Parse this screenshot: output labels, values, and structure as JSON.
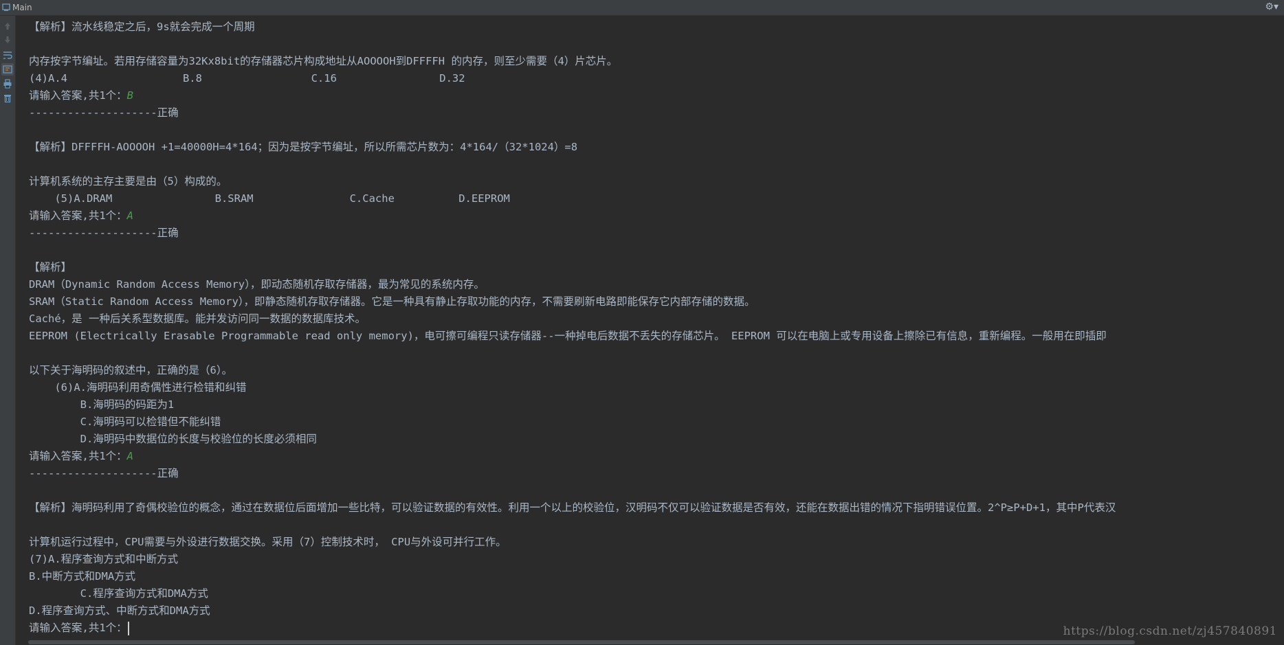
{
  "window": {
    "title": "Main"
  },
  "console": {
    "lines": [
      {
        "text": "【解析】流水线稳定之后，9s就会完成一个周期"
      },
      {
        "text": ""
      },
      {
        "text": "内存按字节编址。若用存储容量为32Kx8bit的存储器芯片构成地址从AOOOOH到DFFFFH 的内存，则至少需要（4）片芯片。"
      },
      {
        "text": "(4)A.4                  B.8                 C.16                D.32"
      },
      {
        "text": "请输入答案,共1个：",
        "input": "B"
      },
      {
        "text": "--------------------正确"
      },
      {
        "text": ""
      },
      {
        "text": "【解析】DFFFFH-AOOOOH +1=40000H=4*164；因为是按字节编址，所以所需芯片数为：4*164/（32*1024）=8"
      },
      {
        "text": ""
      },
      {
        "text": "计算机系统的主存主要是由（5）构成的。"
      },
      {
        "text": "    (5)A.DRAM                B.SRAM               C.Cache          D.EEPROM"
      },
      {
        "text": "请输入答案,共1个：",
        "input": "A"
      },
      {
        "text": "--------------------正确"
      },
      {
        "text": ""
      },
      {
        "text": "【解析】"
      },
      {
        "text": "DRAM（Dynamic Random Access Memory），即动态随机存取存储器，最为常见的系统内存。"
      },
      {
        "text": "SRAM（Static Random Access Memory），即静态随机存取存储器。它是一种具有静止存取功能的内存，不需要刷新电路即能保存它内部存储的数据。"
      },
      {
        "text": "Caché，是 一种后关系型数据库。能并发访问同一数据的数据库技术。"
      },
      {
        "text": "EEPROM (Electrically Erasable Programmable read only memory)，电可擦可编程只读存储器--一种掉电后数据不丢失的存储芯片。 EEPROM 可以在电脑上或专用设备上擦除已有信息，重新编程。一般用在即插即"
      },
      {
        "text": ""
      },
      {
        "text": "以下关于海明码的叙述中，正确的是（6）。"
      },
      {
        "text": "    (6)A.海明码利用奇偶性进行检错和纠错"
      },
      {
        "text": "        B.海明码的码距为1"
      },
      {
        "text": "        C.海明码可以检错但不能纠错"
      },
      {
        "text": "        D.海明码中数据位的长度与校验位的长度必须相同"
      },
      {
        "text": "请输入答案,共1个：",
        "input": "A"
      },
      {
        "text": "--------------------正确"
      },
      {
        "text": ""
      },
      {
        "text": "【解析】海明码利用了奇偶校验位的概念，通过在数据位后面增加一些比特，可以验证数据的有效性。利用一个以上的校验位，汉明码不仅可以验证数据是否有效，还能在数据出错的情况下指明错误位置。2^P≥P+D+1，其中P代表汉"
      },
      {
        "text": ""
      },
      {
        "text": "计算机运行过程中，CPU需要与外设进行数据交换。采用（7）控制技术时， CPU与外设可并行工作。"
      },
      {
        "text": "(7)A.程序查询方式和中断方式"
      },
      {
        "text": "B.中断方式和DMA方式"
      },
      {
        "text": "        C.程序查询方式和DMA方式"
      },
      {
        "text": "D.程序查询方式、中断方式和DMA方式"
      },
      {
        "text": "请输入答案,共1个：",
        "cursor": true
      }
    ]
  },
  "watermark": "https://blog.csdn.net/zj457840891",
  "icons": {
    "titlebar": [
      "run-tab-icon",
      "settings-gear-icon"
    ],
    "toolbar": [
      "up-arrow-icon",
      "down-arrow-icon",
      "soft-wrap-icon",
      "scroll-to-end-icon",
      "print-icon",
      "trash-icon"
    ]
  },
  "colors": {
    "background": "#2b2b2b",
    "text": "#a9b7c6",
    "user_input": "#4a9e4a",
    "panel": "#3c3f41"
  }
}
